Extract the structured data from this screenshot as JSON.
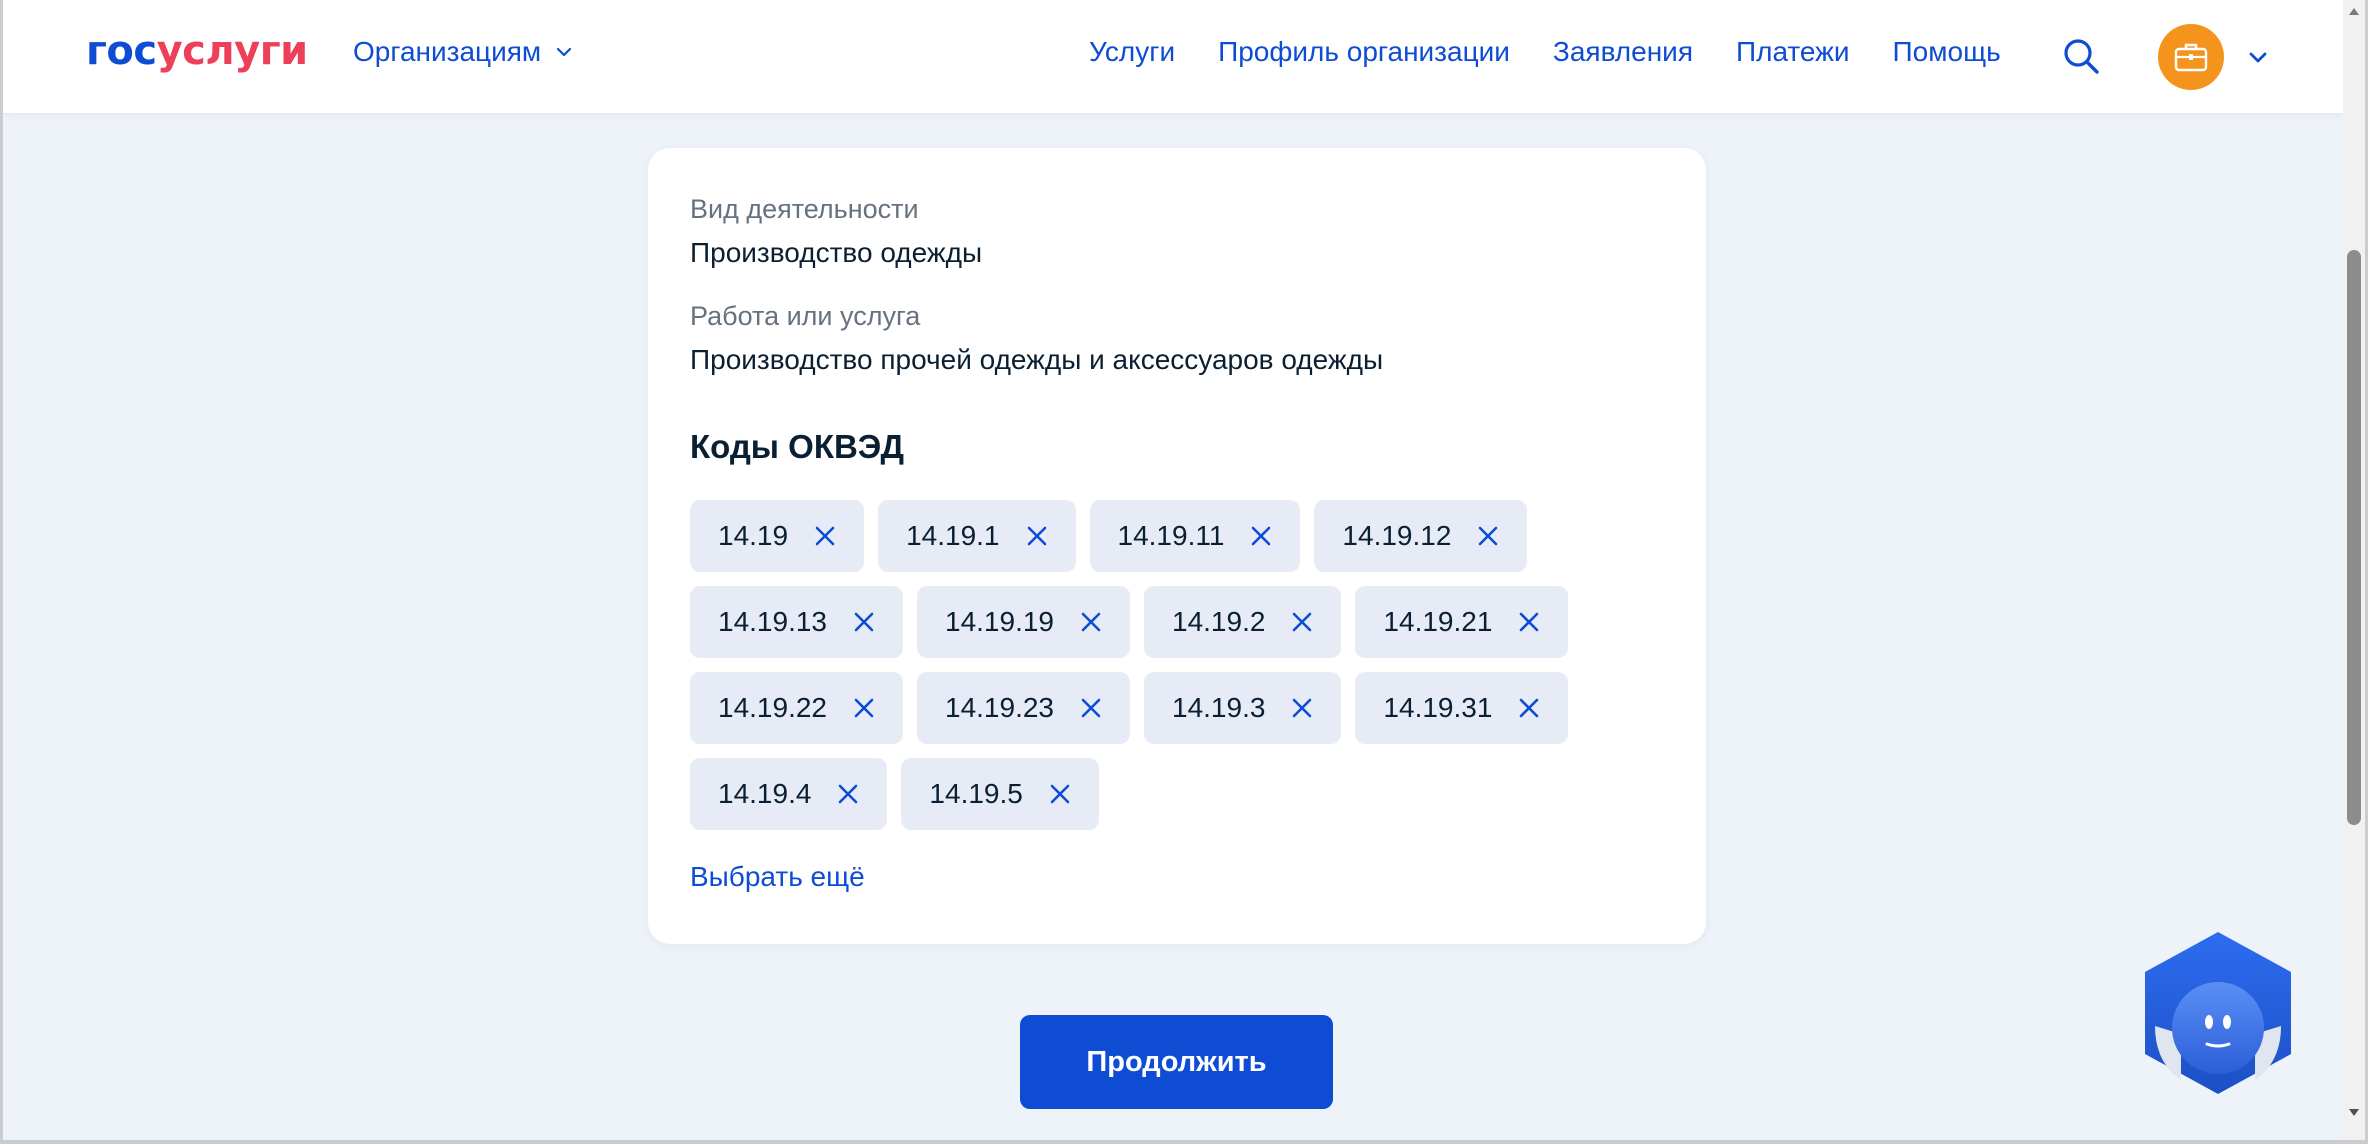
{
  "header": {
    "logo_part1": "гос",
    "logo_part2": "услуги",
    "org_menu_label": "Организациям",
    "nav": [
      {
        "label": "Услуги"
      },
      {
        "label": "Профиль организации"
      },
      {
        "label": "Заявления"
      },
      {
        "label": "Платежи"
      },
      {
        "label": "Помощь"
      }
    ],
    "search_icon": "search-icon",
    "avatar_icon": "briefcase-icon",
    "avatar_color": "#f5941c"
  },
  "card": {
    "activity_label": "Вид деятельности",
    "activity_value": "Производство одежды",
    "service_label": "Работа или услуга",
    "service_value": "Производство прочей одежды и аксессуаров одежды",
    "okved_title": "Коды ОКВЭД",
    "codes": [
      [
        "14.19",
        "14.19.1",
        "14.19.11",
        "14.19.12"
      ],
      [
        "14.19.13",
        "14.19.19",
        "14.19.2",
        "14.19.21"
      ],
      [
        "14.19.22",
        "14.19.23",
        "14.19.3",
        "14.19.31"
      ],
      [
        "14.19.4",
        "14.19.5"
      ]
    ],
    "more_link": "Выбрать ещё"
  },
  "continue_label": "Продолжить",
  "colors": {
    "brand_blue": "#0d4cd3",
    "brand_red": "#ee3f58",
    "page_bg": "#eef2f9",
    "chip_bg": "#e6ebf5"
  }
}
